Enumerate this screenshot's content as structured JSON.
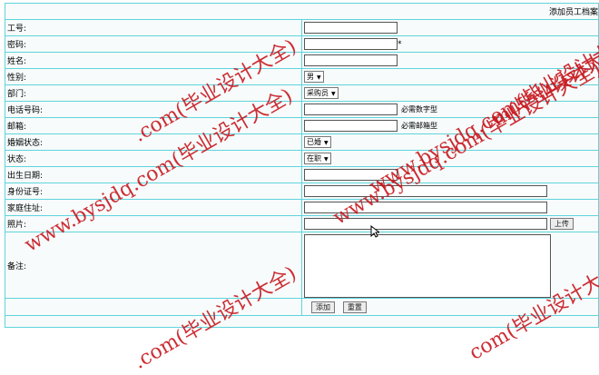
{
  "header": {
    "title": "添加员工档案"
  },
  "fields": {
    "employee_id": {
      "label": "工号:",
      "value": ""
    },
    "password": {
      "label": "密码:",
      "value": "",
      "required_mark": "*"
    },
    "name": {
      "label": "姓名:",
      "value": ""
    },
    "gender": {
      "label": "性别:",
      "selected": "男"
    },
    "department": {
      "label": "部门:",
      "selected": "采购员"
    },
    "phone": {
      "label": "电话号码:",
      "value": "",
      "hint": "必需数字型"
    },
    "email": {
      "label": "邮箱:",
      "value": "",
      "hint": "必需邮箱型"
    },
    "marital_status": {
      "label": "婚姻状态:",
      "selected": "已婚"
    },
    "status": {
      "label": "状态:",
      "selected": "在职"
    },
    "birth_date": {
      "label": "出生日期:",
      "value": ""
    },
    "id_number": {
      "label": "身份证号:",
      "value": ""
    },
    "address": {
      "label": "家庭住址:",
      "value": ""
    },
    "photo": {
      "label": "照片:",
      "value": "",
      "upload_label": "上传"
    },
    "remarks": {
      "label": "备注:",
      "value": ""
    }
  },
  "actions": {
    "add_label": "添加",
    "reset_label": "重置"
  },
  "watermark": {
    "text_a": "www.bysjdq.com(毕业设计大全)",
    "text_b": ".com(毕业设计大全)",
    "text_c": "www.bysjdq.com(毕业设计大全)",
    "text_d": "m(毕业设计大全)",
    "text_e": "www.bysjdq.com(毕业设计大全)",
    "text_f": ".com(毕业设计大全)",
    "text_g": "com(毕业设计大全)",
    "color": "#c8171e"
  },
  "theme": {
    "border_color": "#5fd4dc"
  }
}
